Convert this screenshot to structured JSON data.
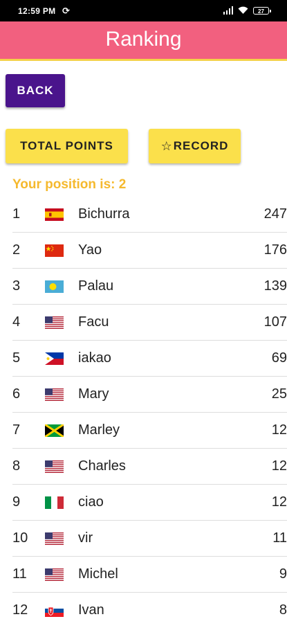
{
  "status": {
    "time": "12:59 PM",
    "battery": "27"
  },
  "header": {
    "title": "Ranking"
  },
  "buttons": {
    "back": "BACK",
    "total_points": "TOTAL POINTS",
    "record": "RECORD",
    "record_icon": "star-outline-icon"
  },
  "position_text": "Your position is: 2",
  "colors": {
    "app_bar": "#f2607f",
    "accent_line": "#f4d24a",
    "back_button": "#4a148c",
    "pill_button": "#fbe04b",
    "position_text": "#f5b92e"
  },
  "rankings": [
    {
      "rank": "1",
      "flag": "spain",
      "name": "Bichurra",
      "points": "247"
    },
    {
      "rank": "2",
      "flag": "china",
      "name": "Yao",
      "points": "176"
    },
    {
      "rank": "3",
      "flag": "palau",
      "name": "Palau",
      "points": "139"
    },
    {
      "rank": "4",
      "flag": "usa",
      "name": "Facu",
      "points": "107"
    },
    {
      "rank": "5",
      "flag": "philippines",
      "name": "iakao",
      "points": "69"
    },
    {
      "rank": "6",
      "flag": "usa",
      "name": "Mary",
      "points": "25"
    },
    {
      "rank": "7",
      "flag": "jamaica",
      "name": "Marley",
      "points": "12"
    },
    {
      "rank": "8",
      "flag": "usa",
      "name": "Charles",
      "points": "12"
    },
    {
      "rank": "9",
      "flag": "italy",
      "name": "ciao",
      "points": "12"
    },
    {
      "rank": "10",
      "flag": "usa",
      "name": "vir",
      "points": "11"
    },
    {
      "rank": "11",
      "flag": "usa",
      "name": "Michel",
      "points": "9"
    },
    {
      "rank": "12",
      "flag": "slovakia",
      "name": "Ivan",
      "points": "8"
    }
  ]
}
